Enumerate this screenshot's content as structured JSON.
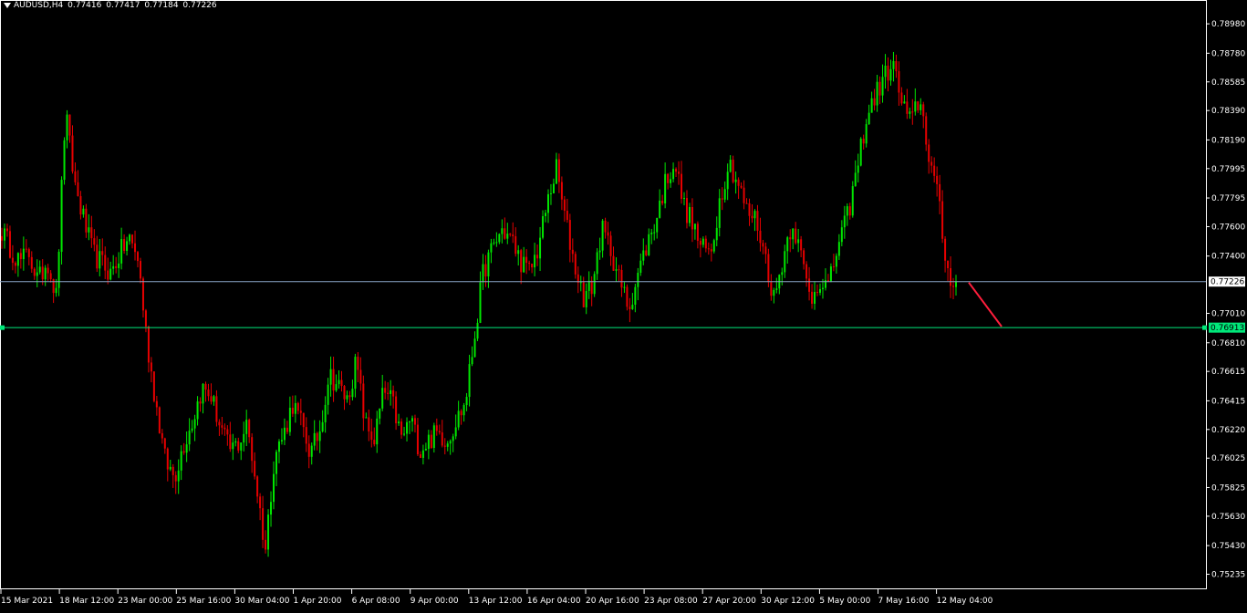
{
  "header": {
    "symbol": "AUDUSD,H4",
    "open": "0.77416",
    "high": "0.77417",
    "low": "0.77184",
    "close": "0.77226"
  },
  "colors": {
    "background": "#000000",
    "bull": "#00e600",
    "bear": "#e60000",
    "frame": "#ffffff",
    "price_line": "#8aa6c8",
    "level_line": "#00e87a",
    "arrow": "#ff1e3c"
  },
  "chart_data": {
    "type": "candlestick",
    "title": "AUDUSD,H4",
    "y_ticks": [
      "0.78980",
      "0.78780",
      "0.78585",
      "0.78390",
      "0.78190",
      "0.77995",
      "0.77795",
      "0.77600",
      "0.77400",
      "0.77010",
      "0.76810",
      "0.76615",
      "0.76415",
      "0.76220",
      "0.76025",
      "0.75825",
      "0.75630",
      "0.75430",
      "0.75235"
    ],
    "x_ticks": [
      "15 Mar 2021",
      "18 Mar 12:00",
      "23 Mar 00:00",
      "25 Mar 16:00",
      "30 Mar 04:00",
      "1 Apr 20:00",
      "6 Apr 08:00",
      "9 Apr 00:00",
      "13 Apr 12:00",
      "16 Apr 04:00",
      "20 Apr 16:00",
      "23 Apr 08:00",
      "27 Apr 20:00",
      "30 Apr 12:00",
      "5 May 00:00",
      "7 May 16:00",
      "12 May 04:00"
    ],
    "ylim": [
      0.7517,
      0.7908
    ],
    "current_price": {
      "value": 0.77226,
      "label": "0.77226"
    },
    "level": {
      "value": 0.76913,
      "label": "0.76913"
    },
    "projection": {
      "from_price": 0.7722,
      "to_price": 0.7692,
      "direction": "down"
    },
    "key_closes": [
      0.7757,
      0.7745,
      0.7736,
      0.7742,
      0.7722,
      0.7738,
      0.7712,
      0.7838,
      0.779,
      0.7765,
      0.7742,
      0.7735,
      0.7728,
      0.7742,
      0.7752,
      0.7738,
      0.768,
      0.7638,
      0.76,
      0.759,
      0.7612,
      0.7628,
      0.765,
      0.7645,
      0.7625,
      0.7608,
      0.7612,
      0.7625,
      0.7585,
      0.754,
      0.7605,
      0.7618,
      0.764,
      0.7625,
      0.7605,
      0.7622,
      0.766,
      0.7652,
      0.7642,
      0.7668,
      0.7625,
      0.7615,
      0.7648,
      0.764,
      0.7615,
      0.763,
      0.7608,
      0.7615,
      0.762,
      0.7615,
      0.7628,
      0.764,
      0.7685,
      0.773,
      0.7745,
      0.7758,
      0.7752,
      0.7738,
      0.7728,
      0.7745,
      0.7775,
      0.78,
      0.7765,
      0.7735,
      0.7712,
      0.772,
      0.7758,
      0.7745,
      0.7722,
      0.7705,
      0.7728,
      0.7748,
      0.7765,
      0.779,
      0.7805,
      0.7775,
      0.7762,
      0.7745,
      0.7742,
      0.7778,
      0.7805,
      0.779,
      0.777,
      0.7765,
      0.774,
      0.771,
      0.774,
      0.7765,
      0.7738,
      0.771,
      0.7725,
      0.7718,
      0.7748,
      0.7765,
      0.7795,
      0.783,
      0.7848,
      0.786,
      0.7872,
      0.7845,
      0.783,
      0.7848,
      0.781,
      0.778,
      0.773,
      0.7722
    ]
  }
}
